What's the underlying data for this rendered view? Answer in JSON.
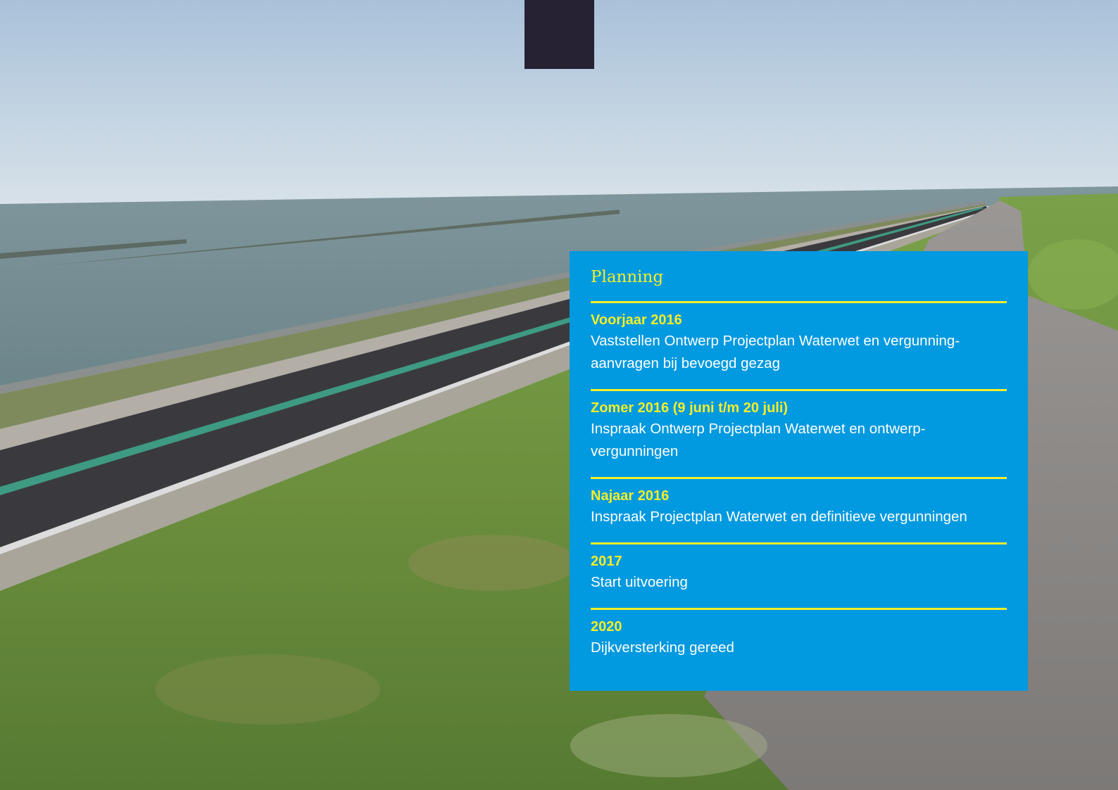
{
  "panel": {
    "title": "Planning",
    "entries": [
      {
        "heading": "Voorjaar  2016",
        "text": "Vaststellen Ontwerp Projectplan Waterwet en vergunning-\naanvragen bij bevoegd gezag"
      },
      {
        "heading": "Zomer 2016 (9 juni t/m 20 juli)",
        "text": "Inspraak Ontwerp Projectplan Waterwet en ontwerp-\nvergunningen"
      },
      {
        "heading": "Najaar 2016",
        "text": "Inspraak Projectplan Waterwet en definitieve vergunningen"
      },
      {
        "heading": "2017",
        "text": "Start uitvoering"
      },
      {
        "heading": "2020",
        "text": "Dijkversterking gereed"
      }
    ]
  },
  "colors": {
    "panel_background": "#0199df",
    "accent_yellow": "#f4ee2a",
    "tab": "#262233"
  }
}
